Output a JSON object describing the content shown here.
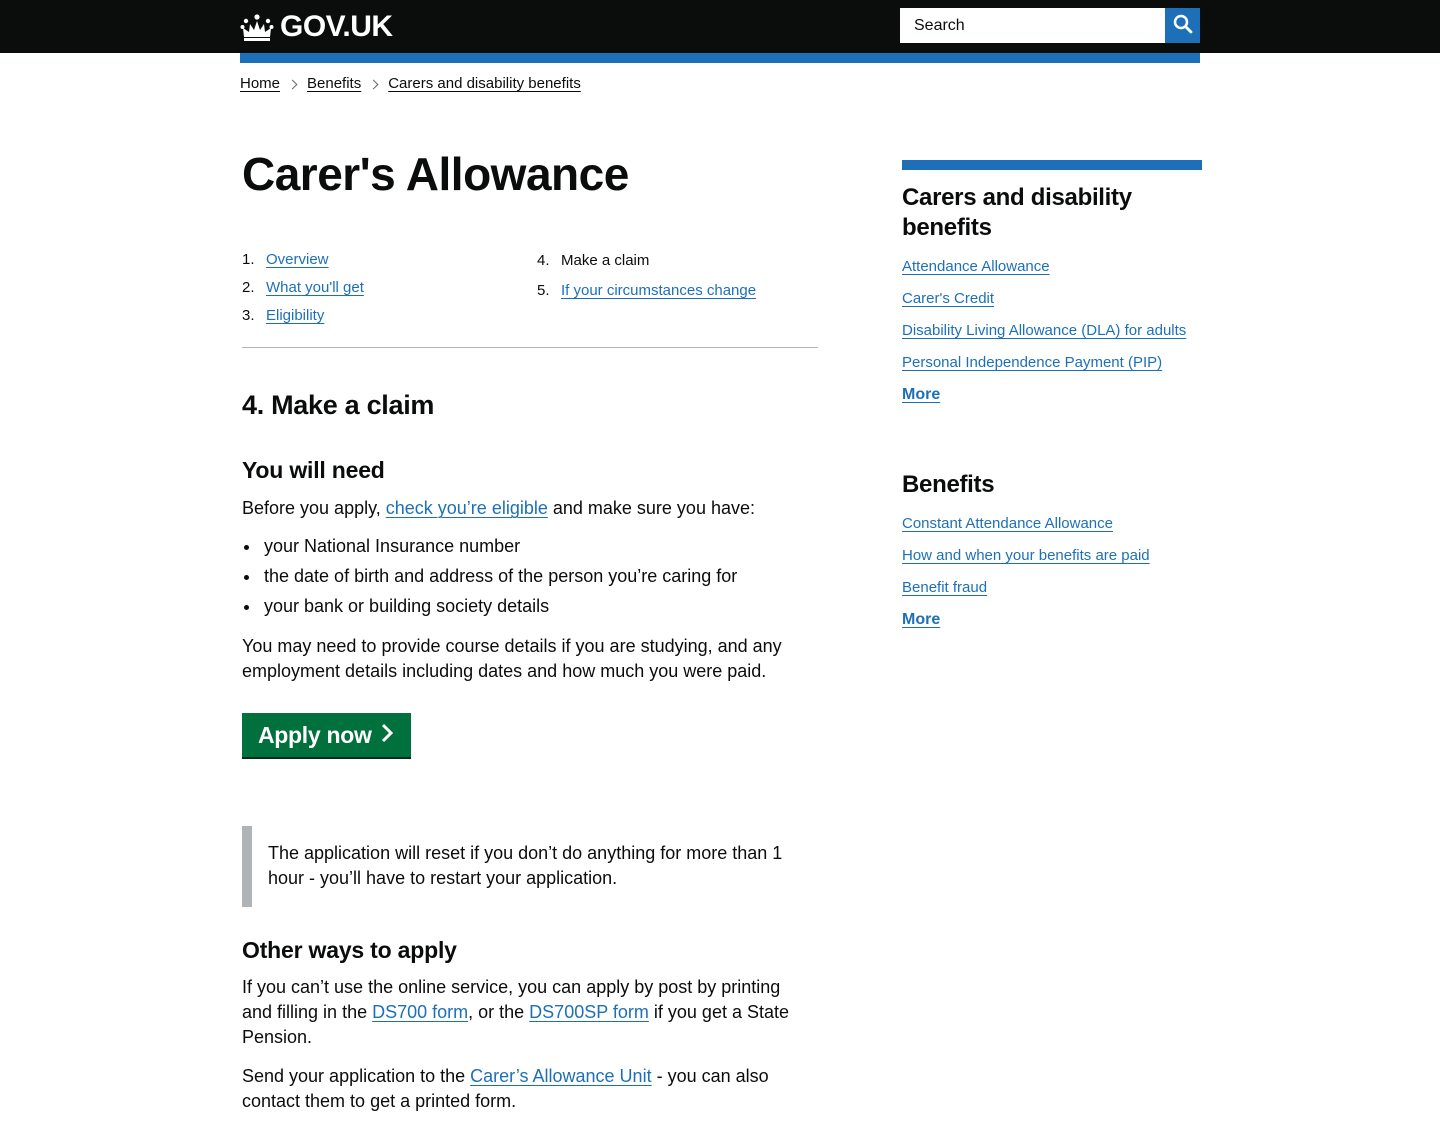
{
  "header": {
    "logo_text": "GOV.UK",
    "search_placeholder": "Search"
  },
  "breadcrumbs": [
    "Home",
    "Benefits",
    "Carers and disability benefits"
  ],
  "page_title": "Carer's Allowance",
  "contents": [
    {
      "num": "1.",
      "label": "Overview",
      "current": false
    },
    {
      "num": "2.",
      "label": "What you'll get",
      "current": false
    },
    {
      "num": "3.",
      "label": "Eligibility",
      "current": false
    },
    {
      "num": "4.",
      "label": "Make a claim",
      "current": true
    },
    {
      "num": "5.",
      "label": "If your circumstances change",
      "current": false
    }
  ],
  "section": {
    "part_title": "4. Make a claim",
    "you_will_need_heading": "You will need",
    "intro_before": "Before you apply, ",
    "intro_link": "check you’re eligible",
    "intro_after": " and make sure you have:",
    "bullets": [
      "your National Insurance number",
      "the date of birth and address of the person you’re caring for",
      "your bank or building society details"
    ],
    "course_details": "You may need to provide course details if you are studying, and any employment details including dates and how much you were paid.",
    "apply_button": "Apply now",
    "inset_text": "The application will reset if you don’t do anything for more than 1 hour - you’ll have to restart your application.",
    "other_ways_heading": "Other ways to apply",
    "post_text_1": "If you can’t use the online service, you can apply by post by printing and filling in the ",
    "ds700_link": "DS700 form",
    "post_text_2": ", or the ",
    "ds700sp_link": "DS700SP form",
    "post_text_3": " if you get a State Pension.",
    "send_text_1": "Send your application to the ",
    "unit_link": "Carer’s Allowance Unit",
    "send_text_2": " - you can also contact them to get a printed form."
  },
  "sidebar": {
    "sections": [
      {
        "title": "Carers and disability benefits",
        "links": [
          "Attendance Allowance",
          "Carer's Credit",
          "Disability Living Allowance (DLA) for adults",
          "Personal Independence Payment (PIP)"
        ],
        "more": "More"
      },
      {
        "title": "Benefits",
        "links": [
          "Constant Attendance Allowance",
          "How and when your benefits are paid",
          "Benefit fraud"
        ],
        "more": "More"
      }
    ]
  },
  "colors": {
    "header_bg": "#0b0c0c",
    "brand_blue": "#1d70b8",
    "link": "#1d70b8",
    "button_green": "#00703c",
    "text": "#0b0c0c",
    "border_grey": "#b1b4b6"
  },
  "icons": [
    "crown-icon",
    "search-icon",
    "chevron-right-icon"
  ]
}
